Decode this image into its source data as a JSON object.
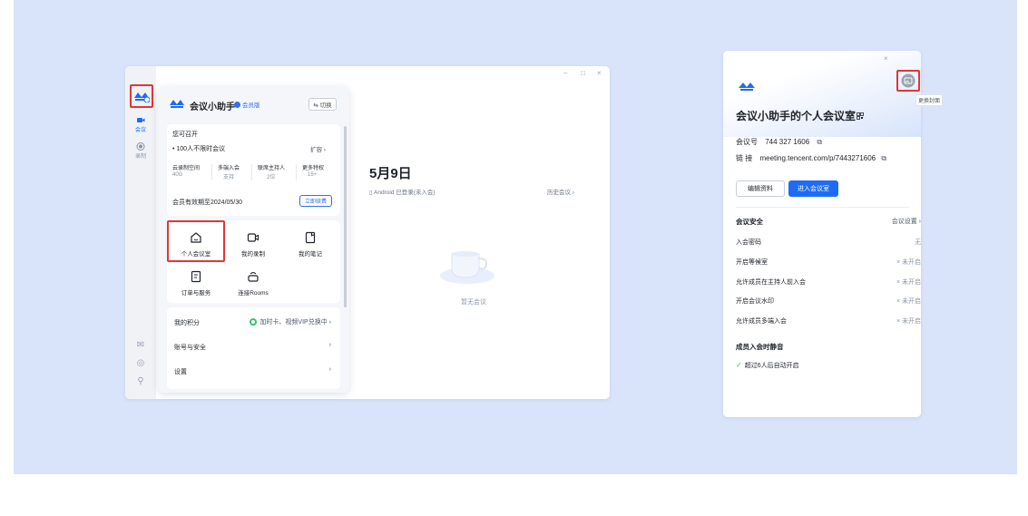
{
  "colors": {
    "accent": "#1e6cf5",
    "highlight": "#e0353a",
    "background": "#d9e4fb",
    "success": "#3cbf6b"
  },
  "rail": {
    "items": [
      {
        "icon": "video-camera-icon",
        "label": "会议"
      },
      {
        "icon": "record-icon",
        "label": "录制"
      }
    ],
    "bottom_icons": [
      "mail-icon",
      "settings-icon",
      "contacts-icon"
    ]
  },
  "window_controls": {
    "minimize": "–",
    "maximize": "□",
    "close": "×"
  },
  "panel": {
    "title": "会议小助手",
    "vip_badge": "会员版",
    "switch_label": "⇆ 切换",
    "can_host_label": "您可召开",
    "meeting_plan": "• 100人不限时会议",
    "expand_label": "扩容 ›",
    "stats": [
      {
        "label": "云录制空间",
        "value": "40G"
      },
      {
        "label": "多端入会",
        "value": "支持"
      },
      {
        "label": "联席主持人",
        "value": "2位"
      },
      {
        "label": "更多特权",
        "value": "15+"
      }
    ],
    "membership_expiry": "会员有效期至2024/05/30",
    "renew_label": "立即续费",
    "grid": [
      {
        "icon": "home-icon",
        "label": "个人会议室"
      },
      {
        "icon": "recording-icon",
        "label": "我的录制"
      },
      {
        "icon": "note-icon",
        "label": "我的笔记"
      },
      {
        "icon": "order-icon",
        "label": "订单与服务"
      },
      {
        "icon": "rooms-icon",
        "label": "连接Rooms"
      }
    ],
    "points_label": "我的积分",
    "points_promo": "加时卡、视频VIP兑换中 ›",
    "account_label": "账号与安全",
    "settings_label": "设置",
    "arrow": "›"
  },
  "main": {
    "date": "5月9日",
    "device_status": "▯ Android 已登录(未入会)",
    "history_link": "历史会议 ›",
    "empty_text": "暂无会议"
  },
  "detail": {
    "close": "×",
    "cover_tooltip": "更换封面",
    "title": "会议小助手的个人会议室",
    "meeting_id_label": "会议号",
    "meeting_id": "744 327 1606",
    "link_label": "链 接",
    "link": "meeting.tencent.com/p/7443271606",
    "edit_label": "编辑资料",
    "enter_label": "进入会议室",
    "security_title": "会议安全",
    "security_settings": "会议设置 ›",
    "rows": [
      {
        "label": "入会密码",
        "value": "无"
      },
      {
        "label": "开启等候室",
        "value": "× 未开启"
      },
      {
        "label": "允许成员在主持人前入会",
        "value": "× 未开启"
      },
      {
        "label": "开启会议水印",
        "value": "× 未开启"
      },
      {
        "label": "允许成员多端入会",
        "value": "× 未开启"
      }
    ],
    "mute_title": "成员入会时静音",
    "mute_value": "超过6人后自动开启"
  }
}
